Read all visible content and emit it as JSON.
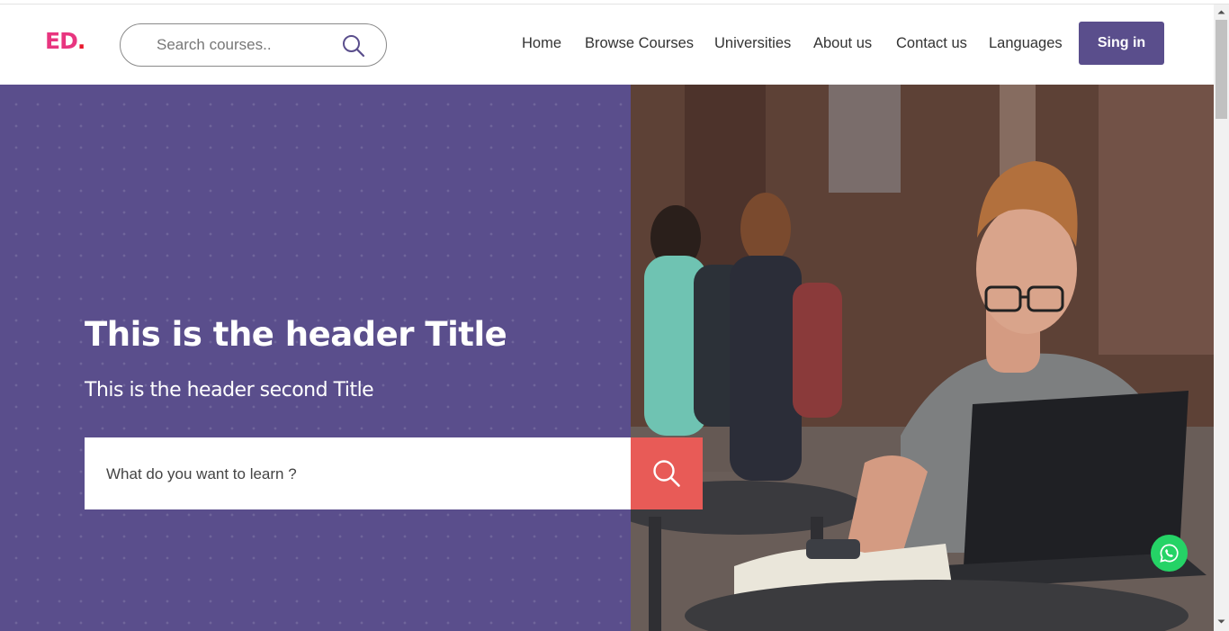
{
  "logo": {
    "text": "ED",
    "dot": "."
  },
  "search": {
    "placeholder": "Search courses.."
  },
  "nav": {
    "home": "Home",
    "browse": "Browse Courses",
    "universities": "Universities",
    "about": "About us",
    "contact": "Contact us",
    "languages": "Languages"
  },
  "signin_label": "Sing in",
  "hero": {
    "title": "This is the header Title",
    "subtitle": "This is the header second Title",
    "learn_placeholder": "What do you want to learn ?"
  },
  "colors": {
    "brand_purple": "#5a4e8c",
    "logo_pink": "#e8357f",
    "search_button_red": "#e85b57",
    "whatsapp_green": "#25d366"
  },
  "icons": {
    "header_search": "search-icon",
    "hero_search": "search-icon",
    "chat": "whatsapp-icon",
    "scroll_up": "scroll-up-arrow-icon",
    "scroll_down": "scroll-down-arrow-icon"
  }
}
